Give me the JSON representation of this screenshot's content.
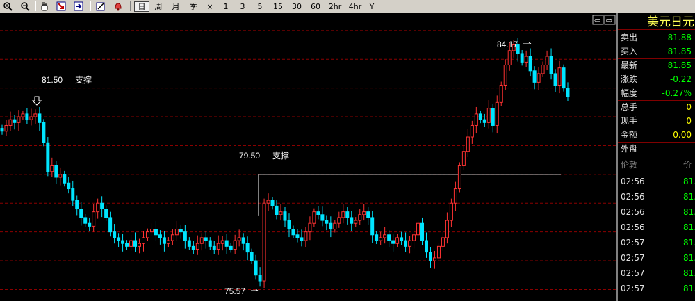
{
  "toolbar": {
    "icons": [
      "zoom-in-icon",
      "zoom-out-icon",
      "hand-icon",
      "export-icon",
      "import-icon",
      "draw-icon",
      "alert-bell-icon"
    ],
    "periods": [
      "日",
      "周",
      "月",
      "季",
      "×",
      "1",
      "3",
      "5",
      "15",
      "30",
      "60",
      "2hr",
      "4hr",
      "Y"
    ],
    "active_period": "日"
  },
  "chart": {
    "annotations": [
      {
        "price": "81.50",
        "label": "支撑"
      },
      {
        "price": "79.50",
        "label": "支撑"
      }
    ],
    "high_label": "84.17",
    "low_label": "75.57",
    "nav_left": "⇦",
    "nav_right": "⇨",
    "colors": {
      "up": "#ff3232",
      "down": "#00e5ff",
      "grid": "#8b0000",
      "support_line": "#ffffff"
    }
  },
  "chart_data": {
    "type": "candlestick",
    "symbol": "美元日元",
    "ylim": [
      75.1,
      85.1
    ],
    "high": 84.17,
    "low": 75.57,
    "support_levels": [
      81.5,
      79.5
    ],
    "closes": [
      81.0,
      81.2,
      81.4,
      81.3,
      81.5,
      81.6,
      81.4,
      81.5,
      81.6,
      81.3,
      80.6,
      79.6,
      79.8,
      79.4,
      79.5,
      79.2,
      79.0,
      78.6,
      78.3,
      78.0,
      77.8,
      77.7,
      78.2,
      78.5,
      78.3,
      78.0,
      77.5,
      77.3,
      77.2,
      77.1,
      77.0,
      77.2,
      77.0,
      77.1,
      77.3,
      77.5,
      77.6,
      77.4,
      77.3,
      77.1,
      77.2,
      77.4,
      77.6,
      77.5,
      77.2,
      77.0,
      76.9,
      77.1,
      77.3,
      77.2,
      77.0,
      76.9,
      77.1,
      77.2,
      77.0,
      76.9,
      77.2,
      77.3,
      77.1,
      76.8,
      76.5,
      76.0,
      75.8,
      78.5,
      78.6,
      78.4,
      78.1,
      78.2,
      77.9,
      77.6,
      77.4,
      77.3,
      77.2,
      77.5,
      77.8,
      78.2,
      78.1,
      77.9,
      77.8,
      77.6,
      77.8,
      78.0,
      78.2,
      78.0,
      77.8,
      77.9,
      78.1,
      78.2,
      78.0,
      77.4,
      77.2,
      77.3,
      77.4,
      77.2,
      77.1,
      77.3,
      77.2,
      77.0,
      77.2,
      77.4,
      77.8,
      77.2,
      76.8,
      76.5,
      76.6,
      77.0,
      77.3,
      77.9,
      78.5,
      79.0,
      79.8,
      80.3,
      80.8,
      81.2,
      81.6,
      81.4,
      81.3,
      81.8,
      81.2,
      82.0,
      82.6,
      83.3,
      83.8,
      84.0,
      83.7,
      83.4,
      83.6,
      83.1,
      82.7,
      83.0,
      83.3,
      83.6,
      83.0,
      82.6,
      83.2,
      82.5,
      82.2
    ],
    "quote": {
      "卖出": "81.88",
      "买入": "81.85",
      "最新": "81.85",
      "涨跌": "-0.22",
      "幅度": "-0.27%",
      "总手": "0",
      "现手": "0",
      "金额": "0.00",
      "外盘": "---"
    }
  },
  "side": {
    "title": "美元日元",
    "quote_rows": [
      {
        "label": "卖出",
        "value": "81.88",
        "color": "#00ff00"
      },
      {
        "label": "买入",
        "value": "81.85",
        "color": "#00ff00"
      },
      {
        "label": "最新",
        "value": "81.85",
        "color": "#00ff00"
      },
      {
        "label": "涨跌",
        "value": "-0.22",
        "color": "#00ff00"
      },
      {
        "label": "幅度",
        "value": "-0.27%",
        "color": "#00ff00"
      },
      {
        "label": "总手",
        "value": "0",
        "color": "#ffff00"
      },
      {
        "label": "现手",
        "value": "0",
        "color": "#ffff00"
      },
      {
        "label": "金额",
        "value": "0.00",
        "color": "#ffff00"
      },
      {
        "label": "外盘",
        "value": "---",
        "color": "#ff4040"
      }
    ],
    "tick_header": {
      "time": "伦敦",
      "price": "价"
    },
    "ticks": [
      {
        "time": "02:56",
        "price": "81."
      },
      {
        "time": "02:56",
        "price": "81."
      },
      {
        "time": "02:56",
        "price": "81."
      },
      {
        "time": "02:56",
        "price": "81."
      },
      {
        "time": "02:57",
        "price": "81."
      },
      {
        "time": "02:57",
        "price": "81."
      },
      {
        "time": "02:57",
        "price": "81."
      },
      {
        "time": "02:57",
        "price": "81."
      }
    ]
  }
}
